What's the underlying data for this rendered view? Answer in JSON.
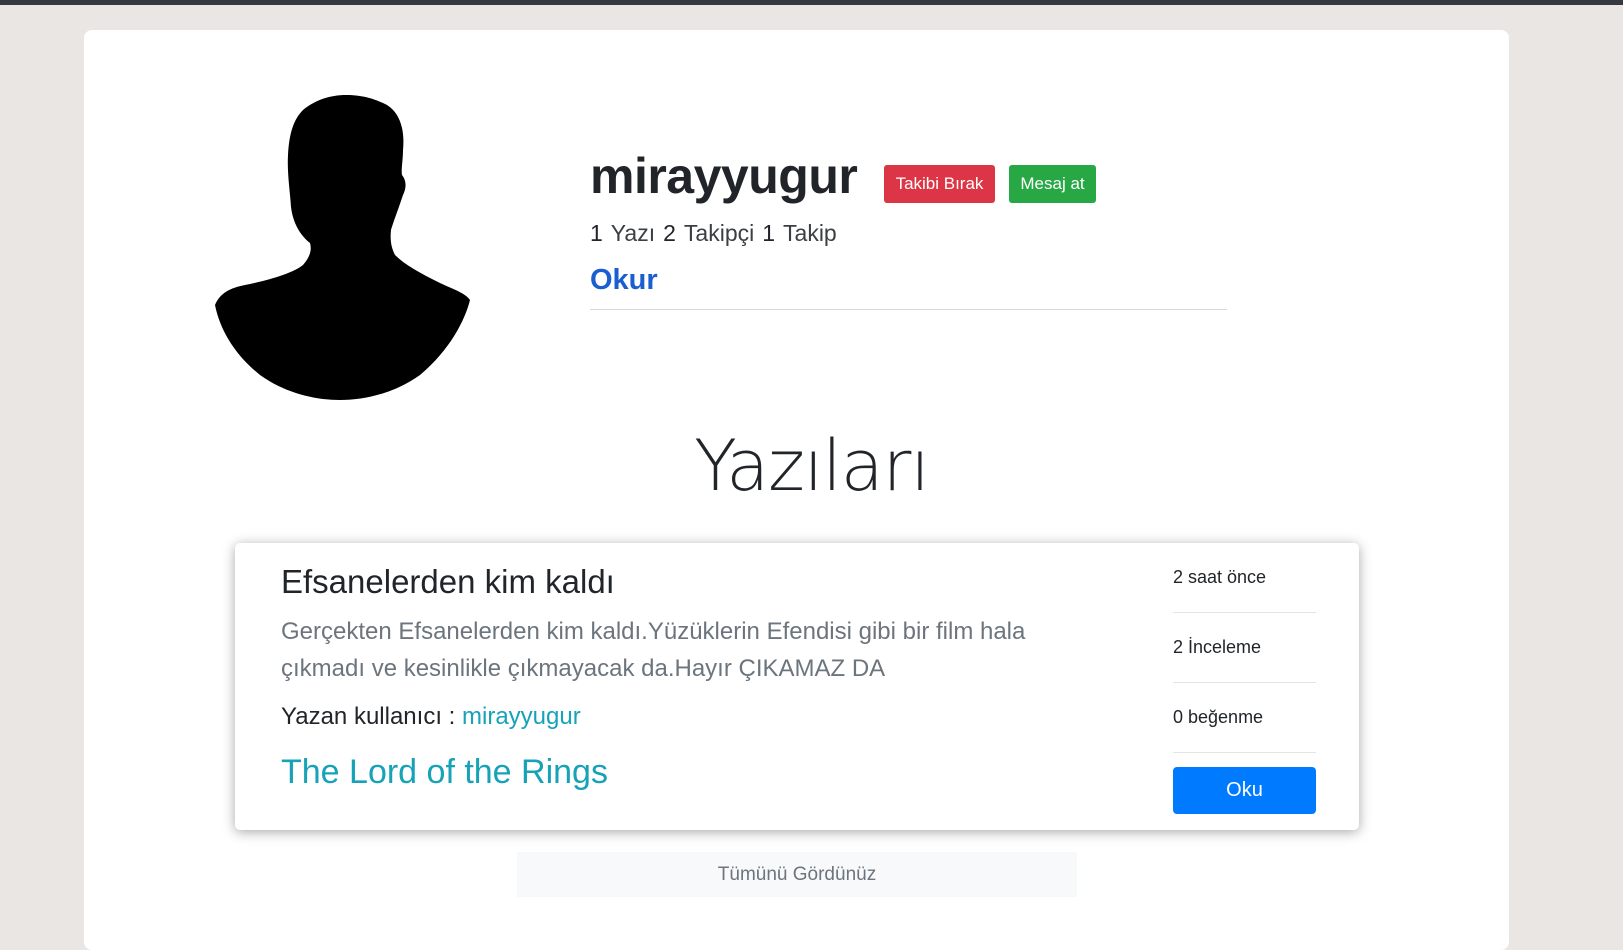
{
  "profile": {
    "username": "mirayyugur",
    "unfollow_label": "Takibi Bırak",
    "message_label": "Mesaj at",
    "stats": {
      "posts_count": "1",
      "posts_label": "Yazı",
      "followers_count": "2",
      "followers_label": "Takipçi",
      "following_count": "1",
      "following_label": "Takip"
    },
    "role": "Okur",
    "avatar_icon": "user-silhouette-icon"
  },
  "posts_section": {
    "title": "Yazıları",
    "posts": [
      {
        "title": "Efsanelerden kim kaldı",
        "excerpt": "Gerçekten Efsanelerden kim kaldı.Yüzüklerin Efendisi gibi bir film hala çıkmadı ve kesinlikle çıkmayacak da.Hayır ÇIKAMAZ DA",
        "author_label": "Yazan kullanıcı :",
        "author": "mirayyugur",
        "tag": "The Lord of the Rings",
        "time": "2 saat önce",
        "reviews": "2 İnceleme",
        "likes": "0 beğenme",
        "read_label": "Oku"
      }
    ],
    "footer": "Tümünü Gördünüz"
  },
  "colors": {
    "unfollow": "#dc3545",
    "message": "#28a745",
    "role": "#1a5fd0",
    "link": "#17a2b8",
    "primary": "#007bff"
  }
}
